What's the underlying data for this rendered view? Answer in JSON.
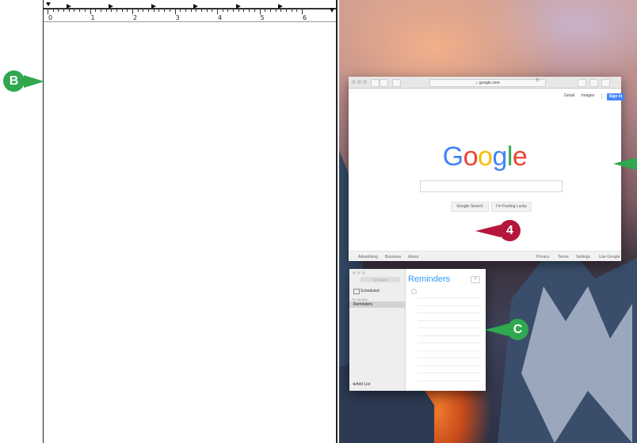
{
  "colors": {
    "callout_green": "#2fa84f",
    "callout_red": "#b5173c",
    "signin_blue": "#4285f4",
    "reminders_blue": "#2f9cf6"
  },
  "ruler": {
    "numbers": [
      "0",
      "1",
      "2",
      "3",
      "4",
      "5",
      "6"
    ]
  },
  "callouts": {
    "b": "B",
    "step4": "4",
    "c": "C"
  },
  "safari": {
    "url": "google.com",
    "top_links": {
      "gmail": "Gmail",
      "images": "Images",
      "signin": "Sign in",
      "apps_icon": "apps-grid-icon"
    },
    "logo": [
      "G",
      "o",
      "o",
      "g",
      "l",
      "e"
    ],
    "logo_colors": [
      "#4285f4",
      "#ea4335",
      "#fbbc05",
      "#4285f4",
      "#34a853",
      "#ea4335"
    ],
    "search_button": "Google Search",
    "lucky_button": "I'm Feeling Lucky",
    "footer_left": [
      "Advertising",
      "Business",
      "About"
    ],
    "footer_right": [
      "Privacy",
      "Terms",
      "Settings",
      "Use Google"
    ]
  },
  "reminders": {
    "search_placeholder": "Q Search",
    "scheduled": "Scheduled",
    "on_my_mac": "On My Mac",
    "list_item": "Reminders",
    "add_list": "Add List",
    "title": "Reminders",
    "add_button": "+"
  }
}
